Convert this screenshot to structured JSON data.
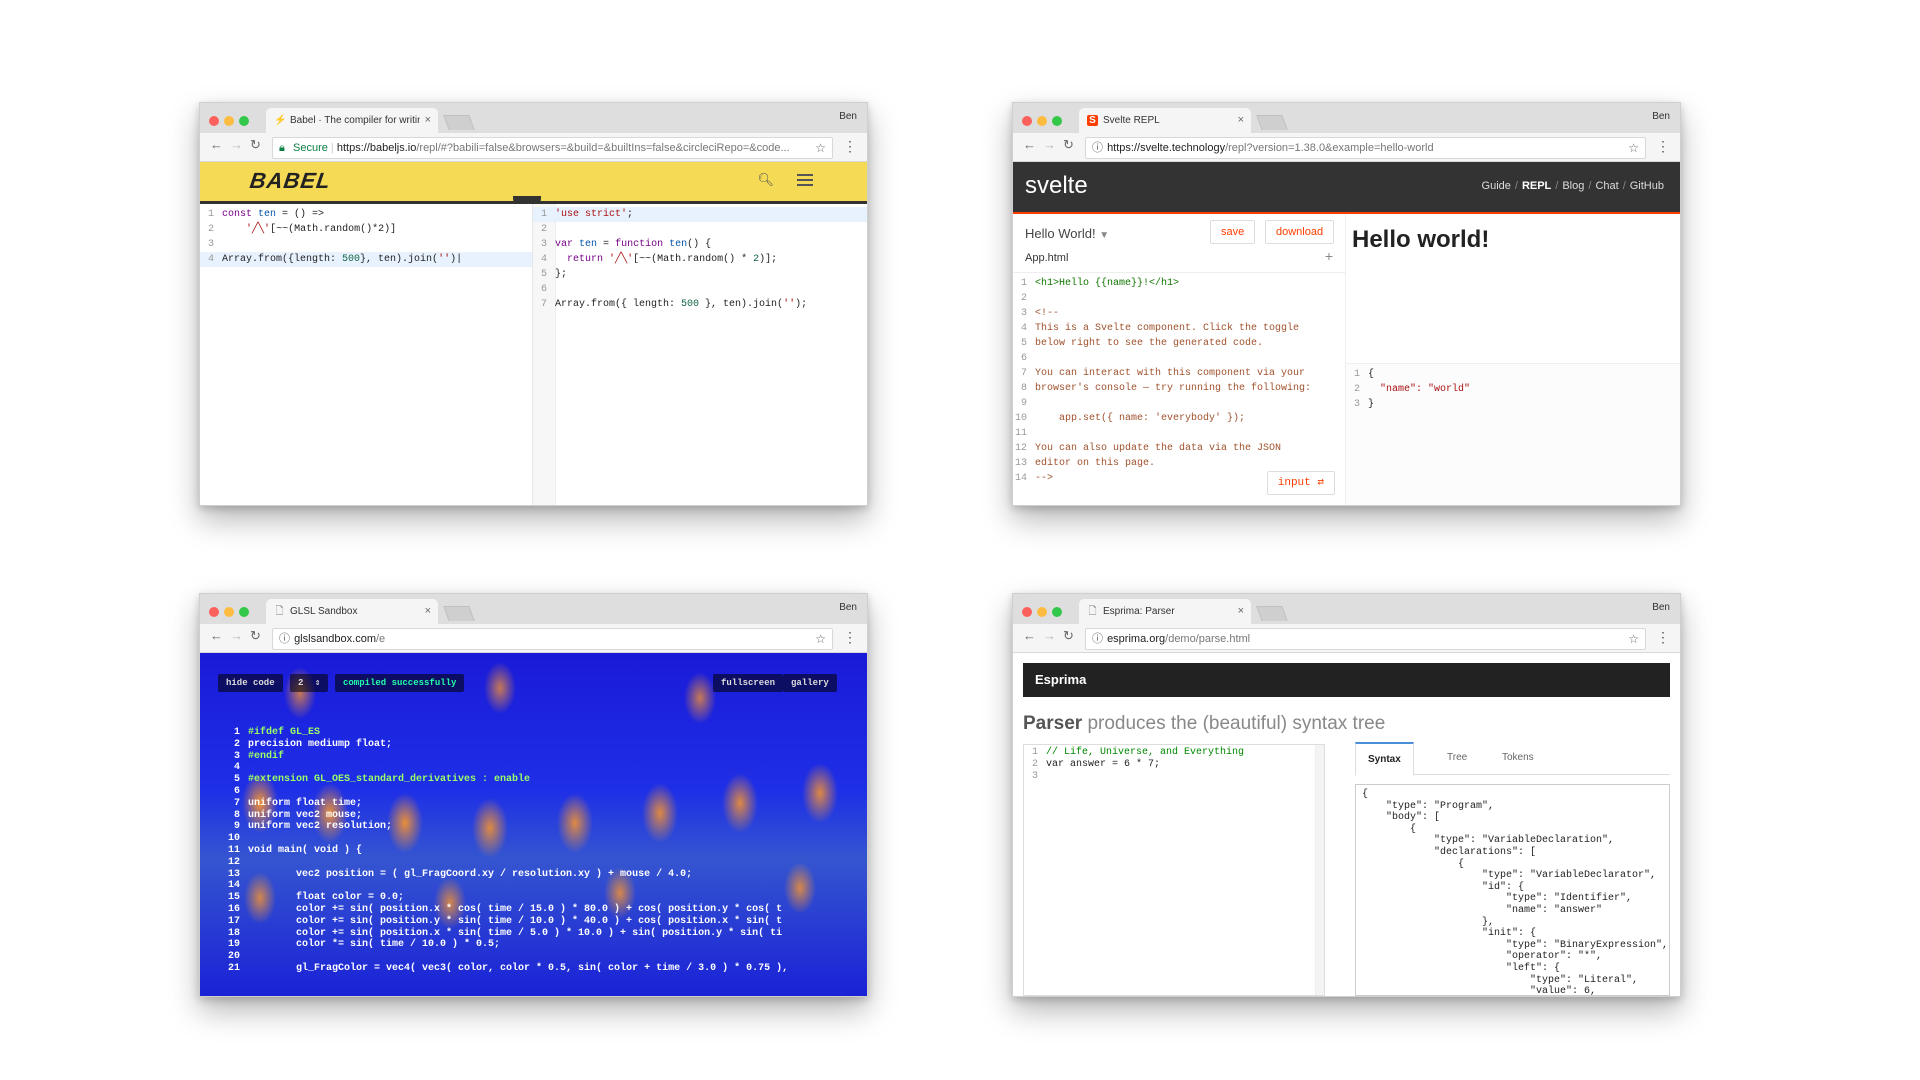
{
  "user": "Ben",
  "babel": {
    "tab_title": "Babel · The compiler for writing",
    "secure_label": "Secure",
    "url_host": "https://babeljs.io",
    "url_rest": "/repl/#?babili=false&browsers=&build=&builtIns=false&circleciRepo=&code...",
    "logo": "BABEL",
    "left_lines": [
      {
        "n": "1",
        "t": "const ten = () =>"
      },
      {
        "n": "2",
        "t": "    '╱╲'[~~(Math.random()*2)]"
      },
      {
        "n": "3",
        "t": ""
      },
      {
        "n": "4",
        "t": "Array.from({length: 500}, ten).join('')"
      }
    ],
    "right_lines": [
      {
        "n": "1",
        "t": "'use strict';"
      },
      {
        "n": "2",
        "t": ""
      },
      {
        "n": "3",
        "t": "var ten = function ten() {"
      },
      {
        "n": "4",
        "t": "  return '╱╲'[~~(Math.random() * 2)];"
      },
      {
        "n": "5",
        "t": "};"
      },
      {
        "n": "6",
        "t": ""
      },
      {
        "n": "7",
        "t": "Array.from({ length: 500 }, ten).join('');"
      }
    ]
  },
  "svelte": {
    "tab_title": "Svelte REPL",
    "url_host": "https://svelte.technology",
    "url_rest": "/repl?version=1.38.0&example=hello-world",
    "logo": "svelte",
    "nav": [
      "Guide",
      "REPL",
      "Blog",
      "Chat",
      "GitHub"
    ],
    "example_name": "Hello World!",
    "save_label": "save",
    "download_label": "download",
    "file_tab": "App.html",
    "code_lines": [
      {
        "n": "1",
        "t": "<h1>Hello {{name}}!</h1>"
      },
      {
        "n": "2",
        "t": ""
      },
      {
        "n": "3",
        "t": "<!--"
      },
      {
        "n": "4",
        "t": "This is a Svelte component. Click the toggle"
      },
      {
        "n": "5",
        "t": "below right to see the generated code."
      },
      {
        "n": "6",
        "t": ""
      },
      {
        "n": "7",
        "t": "You can interact with this component via your"
      },
      {
        "n": "8",
        "t": "browser's console — try running the following:"
      },
      {
        "n": "9",
        "t": ""
      },
      {
        "n": "10",
        "t": "    app.set({ name: 'everybody' });"
      },
      {
        "n": "11",
        "t": ""
      },
      {
        "n": "12",
        "t": "You can also update the data via the JSON"
      },
      {
        "n": "13",
        "t": "editor on this page."
      },
      {
        "n": "14",
        "t": "-->"
      }
    ],
    "input_label": "input",
    "output_heading": "Hello world!",
    "json_lines": [
      {
        "n": "1",
        "t": "{"
      },
      {
        "n": "2",
        "t": "  \"name\": \"world\""
      },
      {
        "n": "3",
        "t": "}"
      }
    ]
  },
  "glsl": {
    "tab_title": "GLSL Sandbox",
    "url_host": "glslsandbox.com",
    "url_rest": "/e",
    "hide_code": "hide code",
    "quality": "2",
    "status": "compiled successfully",
    "fullscreen": "fullscreen",
    "gallery": "gallery",
    "code_lines": [
      {
        "n": "1",
        "t": "#ifdef GL_ES"
      },
      {
        "n": "2",
        "t": "precision mediump float;"
      },
      {
        "n": "3",
        "t": "#endif"
      },
      {
        "n": "4",
        "t": ""
      },
      {
        "n": "5",
        "t": "#extension GL_OES_standard_derivatives : enable"
      },
      {
        "n": "6",
        "t": ""
      },
      {
        "n": "7",
        "t": "uniform float time;"
      },
      {
        "n": "8",
        "t": "uniform vec2 mouse;"
      },
      {
        "n": "9",
        "t": "uniform vec2 resolution;"
      },
      {
        "n": "10",
        "t": ""
      },
      {
        "n": "11",
        "t": "void main( void ) {"
      },
      {
        "n": "12",
        "t": ""
      },
      {
        "n": "13",
        "t": "        vec2 position = ( gl_FragCoord.xy / resolution.xy ) + mouse / 4.0;"
      },
      {
        "n": "14",
        "t": ""
      },
      {
        "n": "15",
        "t": "        float color = 0.0;"
      },
      {
        "n": "16",
        "t": "        color += sin( position.x * cos( time / 15.0 ) * 80.0 ) + cos( position.y * cos( t"
      },
      {
        "n": "17",
        "t": "        color += sin( position.y * sin( time / 10.0 ) * 40.0 ) + cos( position.x * sin( t"
      },
      {
        "n": "18",
        "t": "        color += sin( position.x * sin( time / 5.0 ) * 10.0 ) + sin( position.y * sin( ti"
      },
      {
        "n": "19",
        "t": "        color *= sin( time / 10.0 ) * 0.5;"
      },
      {
        "n": "20",
        "t": ""
      },
      {
        "n": "21",
        "t": "        gl_FragColor = vec4( vec3( color, color * 0.5, sin( color + time / 3.0 ) * 0.75 ),"
      }
    ]
  },
  "esprima": {
    "tab_title": "Esprima: Parser",
    "url_host": "esprima.org",
    "url_rest": "/demo/parse.html",
    "brand": "Esprima",
    "title_bold": "Parser",
    "title_rest": " produces the (beautiful) syntax tree",
    "code_lines": [
      {
        "n": "1",
        "t": "// Life, Universe, and Everything"
      },
      {
        "n": "2",
        "t": "var answer = 6 * 7;"
      },
      {
        "n": "3",
        "t": ""
      }
    ],
    "tabs": [
      "Syntax",
      "Tree",
      "Tokens"
    ],
    "output_lines": [
      "{",
      "    \"type\": \"Program\",",
      "    \"body\": [",
      "        {",
      "            \"type\": \"VariableDeclaration\",",
      "            \"declarations\": [",
      "                {",
      "                    \"type\": \"VariableDeclarator\",",
      "                    \"id\": {",
      "                        \"type\": \"Identifier\",",
      "                        \"name\": \"answer\"",
      "                    },",
      "                    \"init\": {",
      "                        \"type\": \"BinaryExpression\",",
      "                        \"operator\": \"*\",",
      "                        \"left\": {",
      "                            \"type\": \"Literal\",",
      "                            \"value\": 6,"
    ]
  }
}
